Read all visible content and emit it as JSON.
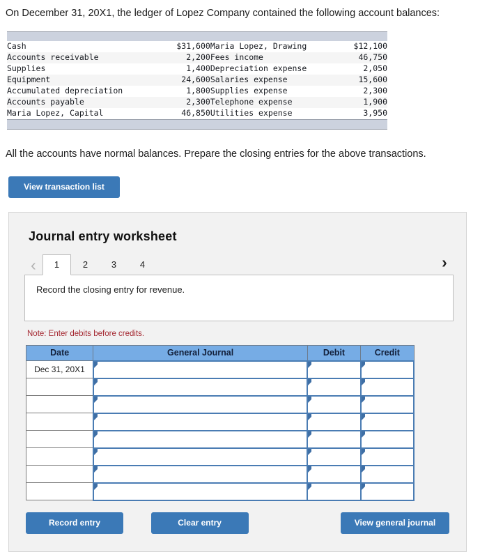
{
  "intro_text": "On December 31, 20X1, the ledger of Lopez Company contained the following account balances:",
  "outro_text": "All the accounts have normal balances. Prepare the closing entries for the above transactions.",
  "ledger": {
    "rows": [
      {
        "left_name": "Cash",
        "left_amount": "$31,600",
        "right_name": "Maria Lopez, Drawing",
        "right_amount": "$12,100"
      },
      {
        "left_name": "Accounts receivable",
        "left_amount": "2,200",
        "right_name": "Fees income",
        "right_amount": "46,750"
      },
      {
        "left_name": "Supplies",
        "left_amount": "1,400",
        "right_name": "Depreciation expense",
        "right_amount": "2,050"
      },
      {
        "left_name": "Equipment",
        "left_amount": "24,600",
        "right_name": "Salaries expense",
        "right_amount": "15,600"
      },
      {
        "left_name": "Accumulated depreciation",
        "left_amount": "1,800",
        "right_name": "Supplies expense",
        "right_amount": "2,300"
      },
      {
        "left_name": "Accounts payable",
        "left_amount": "2,300",
        "right_name": "Telephone expense",
        "right_amount": "1,900"
      },
      {
        "left_name": "Maria Lopez, Capital",
        "left_amount": "46,850",
        "right_name": "Utilities expense",
        "right_amount": "3,950"
      }
    ]
  },
  "view_transaction_list_label": "View transaction list",
  "worksheet": {
    "title": "Journal entry worksheet",
    "prev_icon": "chevron-left-icon",
    "next_icon": "chevron-right-icon",
    "prev_glyph": "‹",
    "next_glyph": "›",
    "tabs": [
      {
        "label": "1",
        "active": true
      },
      {
        "label": "2",
        "active": false
      },
      {
        "label": "3",
        "active": false
      },
      {
        "label": "4",
        "active": false
      }
    ],
    "instruction": "Record the closing entry for revenue.",
    "note": "Note: Enter debits before credits.",
    "journal": {
      "columns": [
        "Date",
        "General Journal",
        "Debit",
        "Credit"
      ],
      "rows": [
        {
          "date": "Dec 31, 20X1",
          "general_journal": "",
          "debit": "",
          "credit": ""
        },
        {
          "date": "",
          "general_journal": "",
          "debit": "",
          "credit": ""
        },
        {
          "date": "",
          "general_journal": "",
          "debit": "",
          "credit": ""
        },
        {
          "date": "",
          "general_journal": "",
          "debit": "",
          "credit": ""
        },
        {
          "date": "",
          "general_journal": "",
          "debit": "",
          "credit": ""
        },
        {
          "date": "",
          "general_journal": "",
          "debit": "",
          "credit": ""
        },
        {
          "date": "",
          "general_journal": "",
          "debit": "",
          "credit": ""
        },
        {
          "date": "",
          "general_journal": "",
          "debit": "",
          "credit": ""
        }
      ]
    },
    "record_entry_label": "Record entry",
    "clear_entry_label": "Clear entry",
    "view_general_journal_label": "View general journal"
  },
  "colors": {
    "button_blue": "#3b79b7",
    "header_blue": "#76ace5",
    "band_grey": "#ccd2de",
    "note_red": "#a52a33",
    "card_grey": "#f2f2f2",
    "cell_border_blue": "#4a7cb3"
  }
}
